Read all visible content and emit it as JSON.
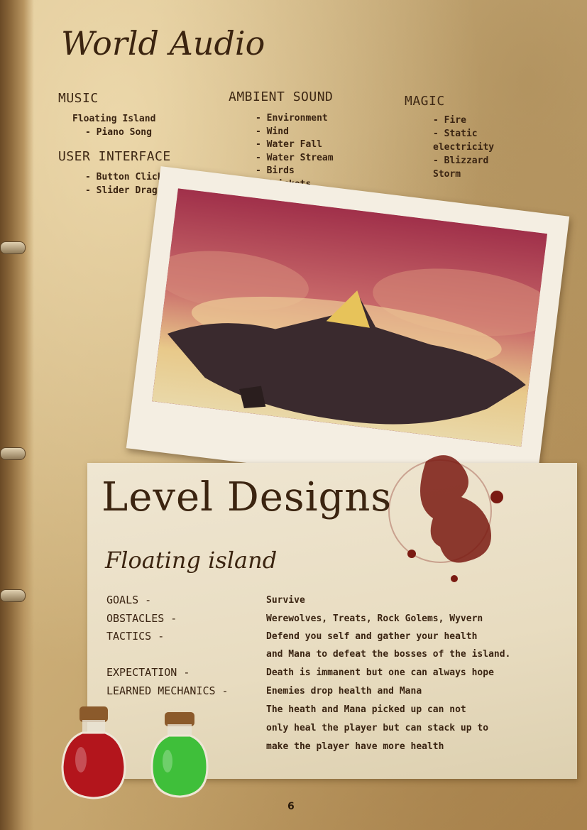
{
  "world_audio": {
    "title": "World Audio",
    "music": {
      "heading": "MUSIC",
      "items": [
        "Floating Island",
        "- Piano Song"
      ]
    },
    "user_interface": {
      "heading": "USER INTERFACE",
      "items": [
        "- Button Click",
        "- Slider Drag"
      ]
    },
    "ambient": {
      "heading": "AMBIENT SOUND",
      "items": [
        "- Environment",
        "- Wind",
        "- Water Fall",
        "- Water Stream",
        "- Birds",
        "- Crickets"
      ]
    },
    "magic": {
      "heading": "MAGIC",
      "items": [
        "- Fire",
        "- Static",
        "electricity",
        "- Blizzard",
        "Storm"
      ]
    }
  },
  "level_designs": {
    "title": "Level Designs",
    "subtitle": "Floating island",
    "rows": [
      {
        "label": "GOALS -",
        "lines": [
          "Survive"
        ]
      },
      {
        "label": "OBSTACLES -",
        "lines": [
          "Werewolves, Treats, Rock Golems, Wyvern"
        ]
      },
      {
        "label": "TACTICS -",
        "lines": [
          "Defend you self and gather your health",
          "and Mana to defeat the bosses of the island."
        ]
      },
      {
        "label": "EXPECTATION -",
        "lines": [
          "Death is immanent but one can always hope"
        ]
      },
      {
        "label": "LEARNED MECHANICS -",
        "lines": [
          "Enemies drop health and Mana",
          "The heath and Mana picked up can not",
          "only heal the player but can stack up to",
          "make the player have more health"
        ]
      }
    ]
  },
  "page_number": "6",
  "colors": {
    "ink": "#3a2412",
    "parchment": "#cdb07a",
    "potion_red": "#b3151c",
    "potion_green": "#3fbf3a",
    "wine_stain": "#7a1a12"
  }
}
